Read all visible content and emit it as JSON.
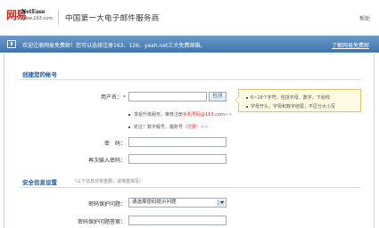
{
  "header": {
    "logo_cn": "网易",
    "logo_en": "NetEase",
    "logo_domain": "www.163.com",
    "slogan": "中国第一大电子邮件服务商",
    "help": "帮助"
  },
  "notice": {
    "text": "欢迎注册网易免费邮！您可以选择注册163、126、yeah.net三大免费邮箱。",
    "link": "了解网易免费邮"
  },
  "section1": {
    "title": "创建您的帐号"
  },
  "form": {
    "username_label": "用户名：",
    "required_mark": "*",
    "check_button": "检测",
    "tips": [
      "6~18个字符，包括字母、数字、下划线",
      "字母开头，字母和数字结尾，不区分大小写"
    ],
    "suggest1_prefix": "享受升级服务，推荐注册",
    "suggest1_link": "手机号码@163.com",
    "suggest1_suffix": ">>",
    "suggest2_prefix": "抢注！数字靓号，靓账号（",
    "suggest2_paid": "付费",
    "suggest2_suffix": "）>>",
    "password_label": "密　码：",
    "repassword_label": "再次输入密码："
  },
  "section2": {
    "title": "安全信息设置",
    "note": "（以下信息非常重要，请慎重填写）"
  },
  "security": {
    "question_label": "密码保护问题：",
    "question_value": "请选择密码提示问题",
    "answer_label": "密码保护问题答案："
  },
  "colors": {
    "brand_red": "#d8261d",
    "notice_blue": "#3f74ad",
    "section_blue": "#1f5fa6"
  }
}
